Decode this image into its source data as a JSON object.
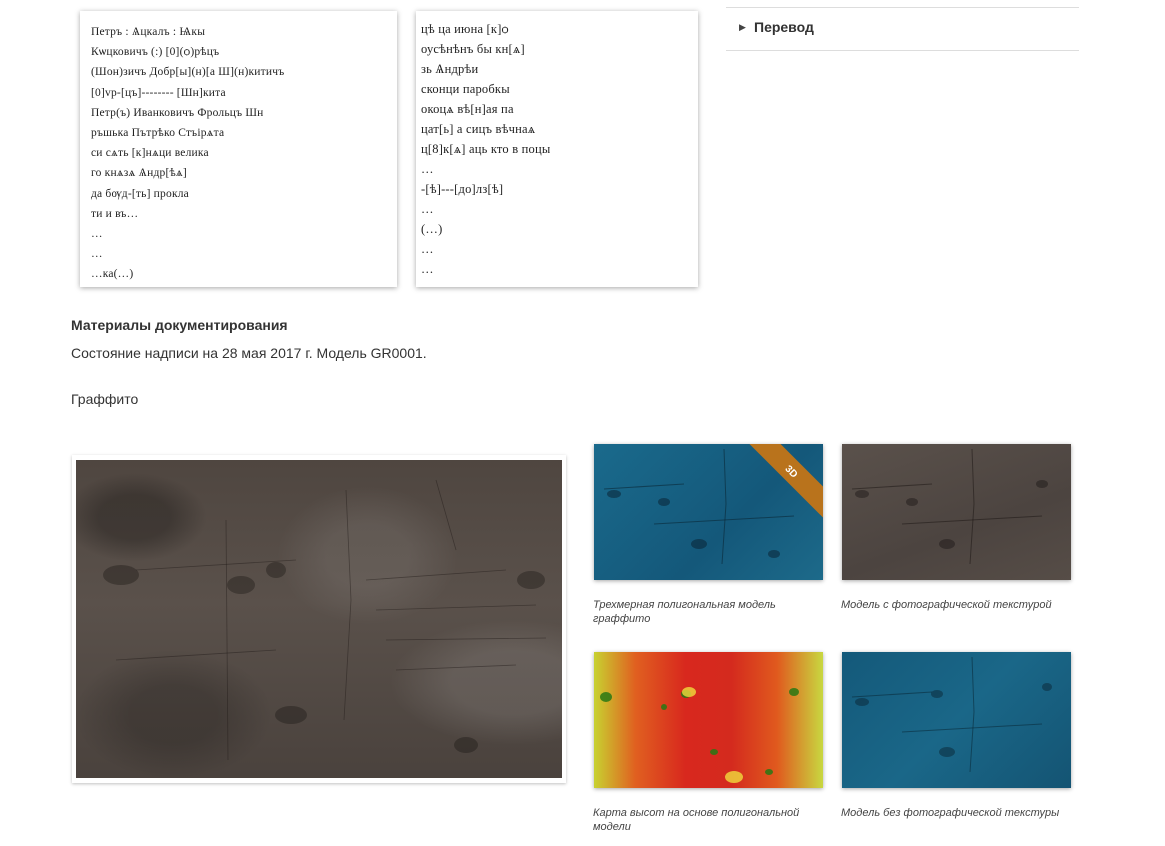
{
  "inscription_left": {
    "lines": [
      "Петръ : Ѧцкалъ : Ѩкы",
      "Кѡцковичъ (:) [0](ѻ)рѣцъ",
      "(Шон)зичъ Добр[ы](н)[а Ш](н)китичъ",
      "[0]vр-[цъ]-------- [Шн]кита",
      "Петр(ъ) Иванковичъ Фрольцъ Шн",
      "ръшька Пътрѣко Стъiрѧта",
      "си сѧть [к]нѧци велика",
      "го кнѧзѧ Ѧндр[ѣѧ]",
      "да бѹд-[ть] прокла",
      "ти и въ…",
      "…",
      "…",
      "…ка(…)"
    ]
  },
  "inscription_right": {
    "lines": [
      "цѣ ца июна [к]ѻ",
      "оусѣнѣнъ бы кн[ѧ]",
      "зь Ѧндрѣи",
      "сконци паробкы",
      "окоцѧ вѣ[н]ая па",
      "цат[ь] а сицъ вѣчнаѧ",
      "ц[8]к[ѧ] аць кто в поцы",
      "…",
      "-[ѣ]---[до]лз[ѣ]",
      "…",
      "(…)",
      "…",
      "…"
    ]
  },
  "translation": {
    "label": "Перевод",
    "icon": "caret-right-icon"
  },
  "materials": {
    "heading": "Материалы документирования",
    "state": "Состояние надписи на 28 мая 2017 г. Модель GR0001.",
    "graffiti_label": "Граффито"
  },
  "thumbnails": [
    {
      "caption": "Трехмерная полигональная модель граффито",
      "badge": "3D"
    },
    {
      "caption": "Модель с фотографической текстурой"
    },
    {
      "caption": "Карта высот на основе полигональной модели"
    },
    {
      "caption": "Модель без фотографической текстуры"
    }
  ],
  "colors": {
    "model_blue": "#1a6788",
    "ribbon": "#b9731c",
    "stone": "#524943"
  }
}
